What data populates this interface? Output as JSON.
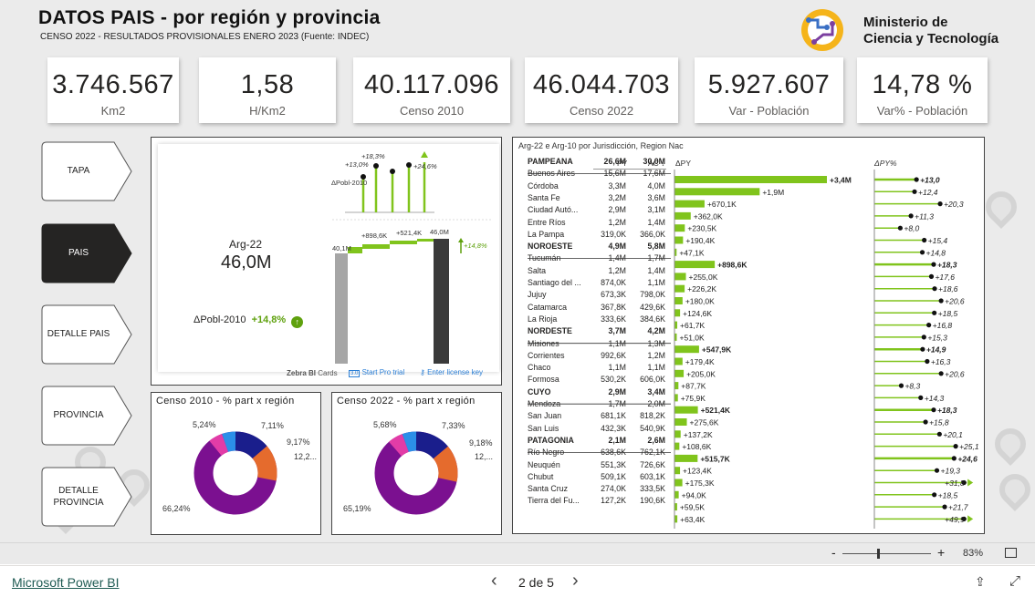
{
  "header": {
    "title": "DATOS PAIS - por región y provincia",
    "subtitle": "CENSO 2022 - RESULTADOS PROVISIONALES ENERO 2023 (Fuente: INDEC)",
    "logo_text_1": "Ministerio de",
    "logo_text_2": "Ciencia y Tecnología"
  },
  "kpis": [
    {
      "value": "3.746.567",
      "label": "Km2"
    },
    {
      "value": "1,58",
      "label": "H/Km2"
    },
    {
      "value": "40.117.096",
      "label": "Censo 2010"
    },
    {
      "value": "46.044.703",
      "label": "Censo 2022"
    },
    {
      "value": "5.927.607",
      "label": "Var - Población"
    },
    {
      "value": "14,78 %",
      "label": "Var% - Población"
    }
  ],
  "nav": [
    {
      "label": "TAPA",
      "active": false
    },
    {
      "label": "PAIS",
      "active": true
    },
    {
      "label": "DETALLE PAIS",
      "active": false
    },
    {
      "label": "PROVINCIA",
      "active": false
    },
    {
      "label": "DETALLE PROVINCIA",
      "active": false
    }
  ],
  "card": {
    "name": "Arg-22",
    "value": "46,0M",
    "delta_label": "ΔPobl-2010",
    "delta_value": "+14,8%",
    "spark_label": "ΔPobl-2010",
    "spark_values": [
      "+13,0%",
      "+18,3%",
      "+24,6%"
    ],
    "bridge_start": "40,1M",
    "bridge_labels": [
      "+898,6K",
      "+521,4K"
    ],
    "bridge_end": "46,0M",
    "bridge_pct": "+14,8%",
    "zebra_label": "Zebra BI",
    "zebra_cards": "Cards",
    "pro_trial": "Start Pro trial",
    "license": "Enter license key",
    "trial_icon": "3.0"
  },
  "donut2010": {
    "title": "Censo 2010 - % part x región",
    "labels": [
      "5,24%",
      "7,11%",
      "9,17%",
      "12,2...",
      "66,24%"
    ]
  },
  "donut2022": {
    "title": "Censo 2022 - % part x región",
    "labels": [
      "5,68%",
      "7,33%",
      "9,18%",
      "12,...",
      "65,19%"
    ]
  },
  "colors": {
    "green": "#80c41c",
    "purple": "#7b1090",
    "orange": "#e56b2d",
    "navy": "#1a1e8c",
    "blue": "#2b8fe8",
    "pink": "#e23ca7",
    "dark": "#252423",
    "gray": "#a6a6a6"
  },
  "table": {
    "title": "Arg-22 e Arg-10 por Jurisdicción, Region Nac",
    "col_py": "PY",
    "col_ac": "AC",
    "col_ac_sort": "↓",
    "col_dpy": "ΔPY",
    "col_dpyp": "ΔPY%",
    "rows": [
      {
        "name": "PAMPEANA",
        "py": "26,6M",
        "ac": "30,0M",
        "dpy": "+3,4M",
        "dpct": "+13,0",
        "bold": true,
        "bar": 3400000,
        "pct": 13.0
      },
      {
        "name": "Buenos Aires",
        "py": "15,6M",
        "ac": "17,6M",
        "dpy": "+1,9M",
        "dpct": "+12,4",
        "bold": false,
        "bar": 1900000,
        "pct": 12.4
      },
      {
        "name": "Córdoba",
        "py": "3,3M",
        "ac": "4,0M",
        "dpy": "+670,1K",
        "dpct": "+20,3",
        "bold": false,
        "bar": 670100,
        "pct": 20.3
      },
      {
        "name": "Santa Fe",
        "py": "3,2M",
        "ac": "3,6M",
        "dpy": "+362,0K",
        "dpct": "+11,3",
        "bold": false,
        "bar": 362000,
        "pct": 11.3
      },
      {
        "name": "Ciudad Autó...",
        "py": "2,9M",
        "ac": "3,1M",
        "dpy": "+230,5K",
        "dpct": "+8,0",
        "bold": false,
        "bar": 230500,
        "pct": 8.0
      },
      {
        "name": "Entre Ríos",
        "py": "1,2M",
        "ac": "1,4M",
        "dpy": "+190,4K",
        "dpct": "+15,4",
        "bold": false,
        "bar": 190400,
        "pct": 15.4
      },
      {
        "name": "La Pampa",
        "py": "319,0K",
        "ac": "366,0K",
        "dpy": "+47,1K",
        "dpct": "+14,8",
        "bold": false,
        "bar": 47100,
        "pct": 14.8
      },
      {
        "name": "NOROESTE",
        "py": "4,9M",
        "ac": "5,8M",
        "dpy": "+898,6K",
        "dpct": "+18,3",
        "bold": true,
        "bar": 898600,
        "pct": 18.3
      },
      {
        "name": "Tucumán",
        "py": "1,4M",
        "ac": "1,7M",
        "dpy": "+255,0K",
        "dpct": "+17,6",
        "bold": false,
        "bar": 255000,
        "pct": 17.6
      },
      {
        "name": "Salta",
        "py": "1,2M",
        "ac": "1,4M",
        "dpy": "+226,2K",
        "dpct": "+18,6",
        "bold": false,
        "bar": 226200,
        "pct": 18.6
      },
      {
        "name": "Santiago del ...",
        "py": "874,0K",
        "ac": "1,1M",
        "dpy": "+180,0K",
        "dpct": "+20,6",
        "bold": false,
        "bar": 180000,
        "pct": 20.6
      },
      {
        "name": "Jujuy",
        "py": "673,3K",
        "ac": "798,0K",
        "dpy": "+124,6K",
        "dpct": "+18,5",
        "bold": false,
        "bar": 124600,
        "pct": 18.5
      },
      {
        "name": "Catamarca",
        "py": "367,8K",
        "ac": "429,6K",
        "dpy": "+61,7K",
        "dpct": "+16,8",
        "bold": false,
        "bar": 61700,
        "pct": 16.8
      },
      {
        "name": "La Rioja",
        "py": "333,6K",
        "ac": "384,6K",
        "dpy": "+51,0K",
        "dpct": "+15,3",
        "bold": false,
        "bar": 51000,
        "pct": 15.3
      },
      {
        "name": "NORDESTE",
        "py": "3,7M",
        "ac": "4,2M",
        "dpy": "+547,9K",
        "dpct": "+14,9",
        "bold": true,
        "bar": 547900,
        "pct": 14.9
      },
      {
        "name": "Misiones",
        "py": "1,1M",
        "ac": "1,3M",
        "dpy": "+179,4K",
        "dpct": "+16,3",
        "bold": false,
        "bar": 179400,
        "pct": 16.3
      },
      {
        "name": "Corrientes",
        "py": "992,6K",
        "ac": "1,2M",
        "dpy": "+205,0K",
        "dpct": "+20,6",
        "bold": false,
        "bar": 205000,
        "pct": 20.6
      },
      {
        "name": "Chaco",
        "py": "1,1M",
        "ac": "1,1M",
        "dpy": "+87,7K",
        "dpct": "+8,3",
        "bold": false,
        "bar": 87700,
        "pct": 8.3
      },
      {
        "name": "Formosa",
        "py": "530,2K",
        "ac": "606,0K",
        "dpy": "+75,9K",
        "dpct": "+14,3",
        "bold": false,
        "bar": 75900,
        "pct": 14.3
      },
      {
        "name": "CUYO",
        "py": "2,9M",
        "ac": "3,4M",
        "dpy": "+521,4K",
        "dpct": "+18,3",
        "bold": true,
        "bar": 521400,
        "pct": 18.3
      },
      {
        "name": "Mendoza",
        "py": "1,7M",
        "ac": "2,0M",
        "dpy": "+275,6K",
        "dpct": "+15,8",
        "bold": false,
        "bar": 275600,
        "pct": 15.8
      },
      {
        "name": "San Juan",
        "py": "681,1K",
        "ac": "818,2K",
        "dpy": "+137,2K",
        "dpct": "+20,1",
        "bold": false,
        "bar": 137200,
        "pct": 20.1
      },
      {
        "name": "San Luis",
        "py": "432,3K",
        "ac": "540,9K",
        "dpy": "+108,6K",
        "dpct": "+25,1",
        "bold": false,
        "bar": 108600,
        "pct": 25.1
      },
      {
        "name": "PATAGONIA",
        "py": "2,1M",
        "ac": "2,6M",
        "dpy": "+515,7K",
        "dpct": "+24,6",
        "bold": true,
        "bar": 515700,
        "pct": 24.6
      },
      {
        "name": "Río Negro",
        "py": "638,6K",
        "ac": "762,1K",
        "dpy": "+123,4K",
        "dpct": "+19,3",
        "bold": false,
        "bar": 123400,
        "pct": 19.3
      },
      {
        "name": "Neuquén",
        "py": "551,3K",
        "ac": "726,6K",
        "dpy": "+175,3K",
        "dpct": "+31,8",
        "bold": false,
        "bar": 175300,
        "pct": 31.8,
        "overflow": true
      },
      {
        "name": "Chubut",
        "py": "509,1K",
        "ac": "603,1K",
        "dpy": "+94,0K",
        "dpct": "+18,5",
        "bold": false,
        "bar": 94000,
        "pct": 18.5
      },
      {
        "name": "Santa Cruz",
        "py": "274,0K",
        "ac": "333,5K",
        "dpy": "+59,5K",
        "dpct": "+21,7",
        "bold": false,
        "bar": 59500,
        "pct": 21.7
      },
      {
        "name": "Tierra del Fu...",
        "py": "127,2K",
        "ac": "190,6K",
        "dpy": "+63,4K",
        "dpct": "+49,9",
        "bold": false,
        "bar": 63400,
        "pct": 49.9,
        "overflow": true
      }
    ]
  },
  "zoom": {
    "minus": "-",
    "plus": "+",
    "value": "83%"
  },
  "footer": {
    "brand": "Microsoft Power BI",
    "page": "2 de 5",
    "prev": "‹",
    "next": "›"
  }
}
